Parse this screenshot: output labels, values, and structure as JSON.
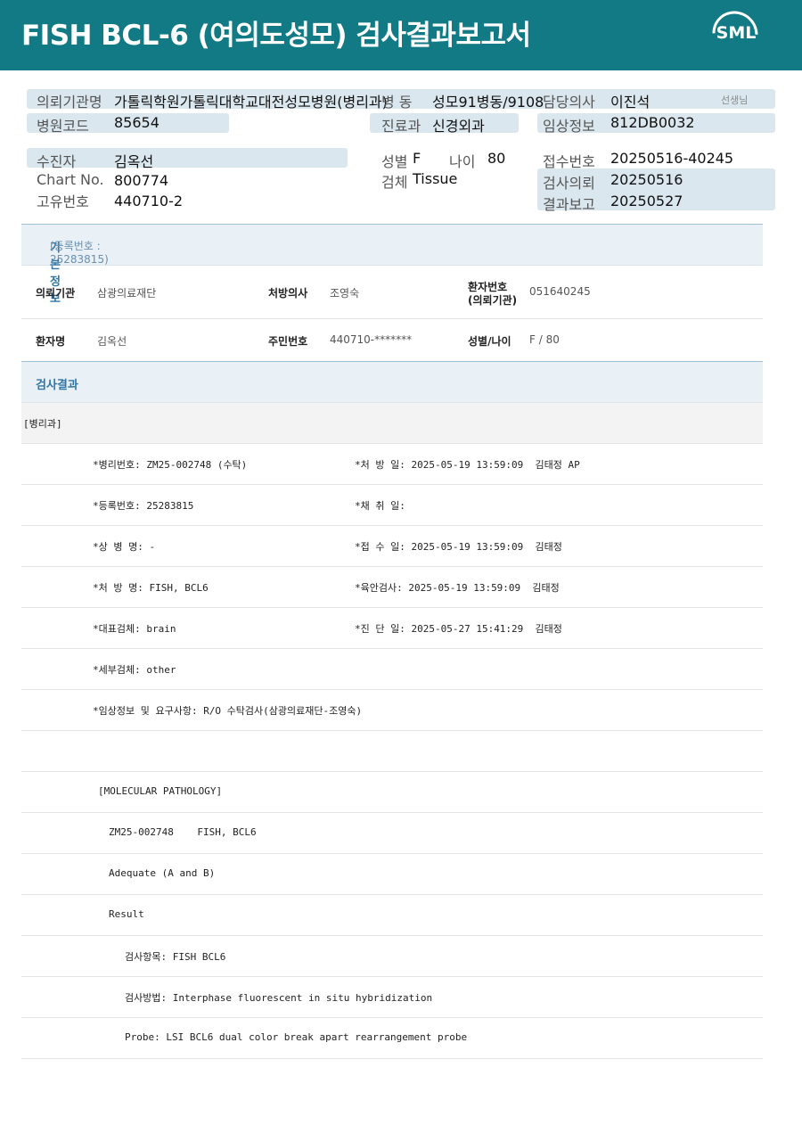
{
  "banner": {
    "title": "FISH BCL-6 (여의도성모) 검사결과보고서",
    "logo": "SML"
  },
  "header": {
    "requesting_institution_label": "의뢰기관명",
    "requesting_institution_value": "가톨릭학원가톨릭대학교대전성모병원(병리과)",
    "ward_label": "병 동",
    "ward_value": "성모91병동/9108",
    "doctor_label": "담당의사",
    "doctor_value": "이진석",
    "doctor_suffix": "선생님",
    "hospital_code_label": "병원코드",
    "hospital_code_value": "85654",
    "department_label": "진료과",
    "department_value": "신경외과",
    "clinical_info_label": "임상정보",
    "clinical_info_value": "812DB0032",
    "patient_label": "수진자",
    "patient_value": "김옥선",
    "sex_label": "성별",
    "sex_value": "F",
    "age_label": "나이",
    "age_value": "80",
    "receipt_label": "접수번호",
    "receipt_value": "20250516-40245",
    "chart_label": "Chart No.",
    "chart_value": "800774",
    "specimen_label": "검체",
    "specimen_value": "Tissue",
    "test_request_label": "검사의뢰",
    "test_request_value": "20250516",
    "unique_label": "고유번호",
    "unique_value": "440710-2",
    "result_report_label": "결과보고",
    "result_report_value": "20250527"
  },
  "basic_info": {
    "title": "기본정보",
    "reg": "(등록번호 : 25283815)",
    "inst_label": "의뢰기관",
    "inst_value": "삼광의료재단",
    "prescriber_label": "처방의사",
    "prescriber_value": "조영숙",
    "patno_label_1": "환자번호",
    "patno_label_2": "(의뢰기관)",
    "patno_value": "051640245",
    "name_label": "환자명",
    "name_value": "김옥선",
    "rrn_label": "주민번호",
    "rrn_value": "440710-*******",
    "sexage_label": "성별/나이",
    "sexage_value": "F / 80"
  },
  "results": {
    "title": "검사결과",
    "dept": "[병리과]",
    "l1a": "*병리번호: ZM25-002748 (수탁)",
    "l1b": "*처 방 일: 2025-05-19 13:59:09  김태정 AP",
    "l2a": "*등록번호: 25283815",
    "l2b": "*채 취 일:",
    "l3a": "*상 병 명: -",
    "l3b": "*접 수 일: 2025-05-19 13:59:09  김태정",
    "l4a": "*처 방 명: FISH, BCL6",
    "l4b": "*육안검사: 2025-05-19 13:59:09  김태정",
    "l5a": "*대표검체: brain",
    "l5b": "*진 단 일: 2025-05-27 15:41:29  김태정",
    "l6a": "*세부검체: other",
    "l7a": "*임상정보 및 요구사항: R/O 수탁검사(삼광의료재단-조영숙)",
    "m1": "[MOLECULAR PATHOLOGY]",
    "m2": "ZM25-002748    FISH, BCL6",
    "m3": "Adequate (A and B)",
    "m4": "Result",
    "m5": "검사항목: FISH BCL6",
    "m6": "검사방법: Interphase fluorescent in situ hybridization",
    "m7": "Probe: LSI BCL6 dual color break apart rearrangement probe"
  }
}
